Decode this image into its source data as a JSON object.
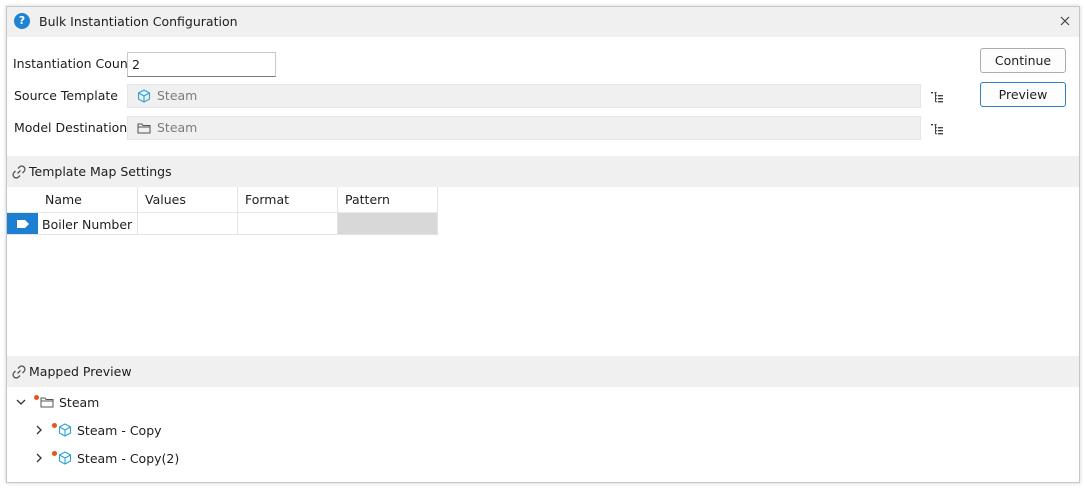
{
  "window": {
    "title": "Bulk Instantiation Configuration",
    "title_icon": "help-icon",
    "close_icon": "close-icon"
  },
  "form": {
    "instantiation_count_label": "Instantiation Count",
    "instantiation_count_value": "2",
    "source_template_label": "Source Template",
    "source_template_value": "Steam",
    "model_destination_label": "Model Destination",
    "model_destination_value": "Steam"
  },
  "buttons": {
    "continue_label": "Continue",
    "preview_label": "Preview"
  },
  "template_map": {
    "section_title": "Template Map Settings",
    "columns": [
      "Name",
      "Values",
      "Format",
      "Pattern"
    ],
    "rows": [
      {
        "name": "Boiler Number",
        "values": "",
        "format": "",
        "pattern": ""
      }
    ]
  },
  "mapped_preview": {
    "section_title": "Mapped Preview",
    "root": {
      "label": "Steam",
      "expanded": true
    },
    "children": [
      {
        "label": "Steam - Copy",
        "expanded": false
      },
      {
        "label": "Steam - Copy(2)",
        "expanded": false
      }
    ]
  },
  "colors": {
    "accent": "#1d83d4",
    "row_selected": "#1d7fd2",
    "status_dot": "#e8531a",
    "template_icon": "#2aa3d8",
    "header_bg": "#f0f0f0"
  }
}
